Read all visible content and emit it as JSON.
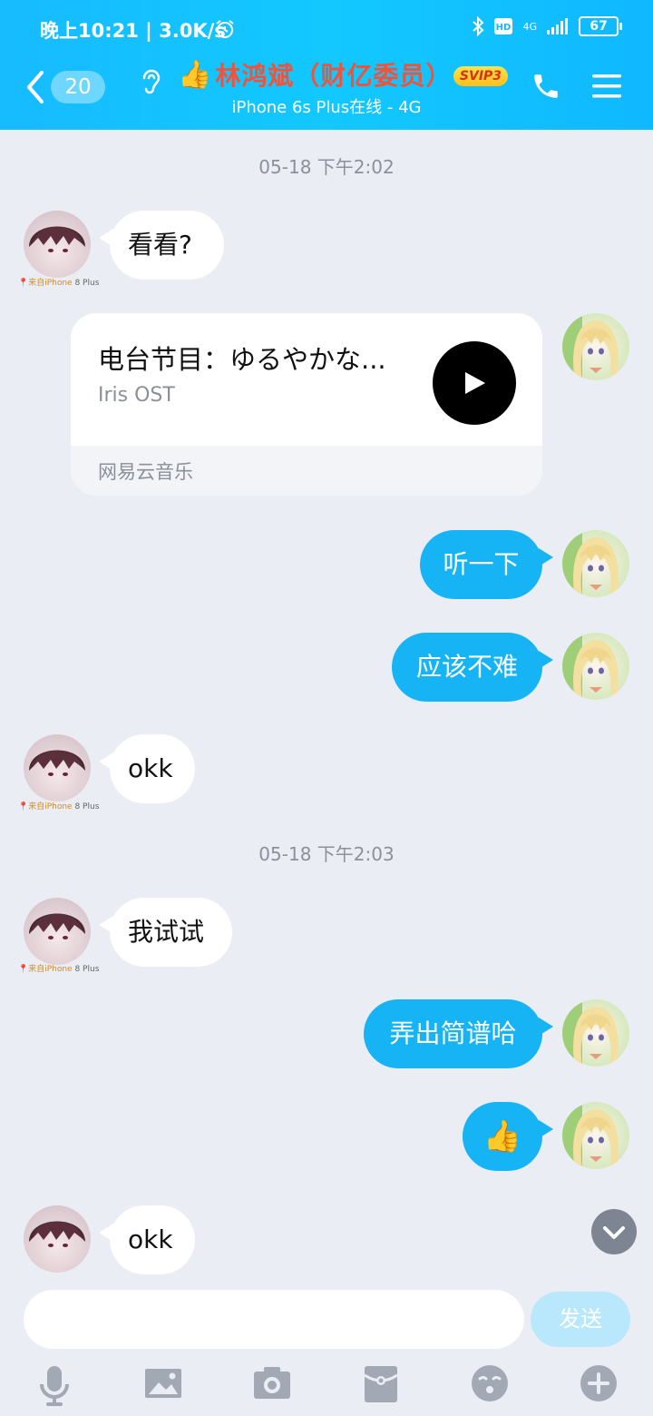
{
  "status_bar": {
    "time": "晚上10:21 | 3.0K/s",
    "battery": "67",
    "network": "4G"
  },
  "header": {
    "unread_count": "20",
    "contact_name": "林鸿斌（财亿委员）",
    "vip_badge": "SVIP3",
    "online_status": "iPhone 6s Plus在线 - 4G"
  },
  "messages": {
    "ts1": "05-18 下午2:02",
    "m1": "看看?",
    "music": {
      "title": "电台节目：ゆるやかな...",
      "artist": "Iris OST",
      "source": "网易云音乐"
    },
    "m2": "听一下",
    "m3": "应该不难",
    "m4": "okk",
    "ts2": "05-18 下午2:03",
    "m5": "我试试",
    "m6": "弄出简谱哈",
    "m7": "👍",
    "m8": "okk"
  },
  "device_tag": {
    "prefix": "来自iPhone",
    "suffix": " 8 Plus"
  },
  "input": {
    "send_label": "发送"
  },
  "colors": {
    "header_bg": "#12c8ff",
    "outgoing_bubble": "#17b4f5",
    "chat_bg": "#eaedf4",
    "name_color": "#f0533a"
  }
}
